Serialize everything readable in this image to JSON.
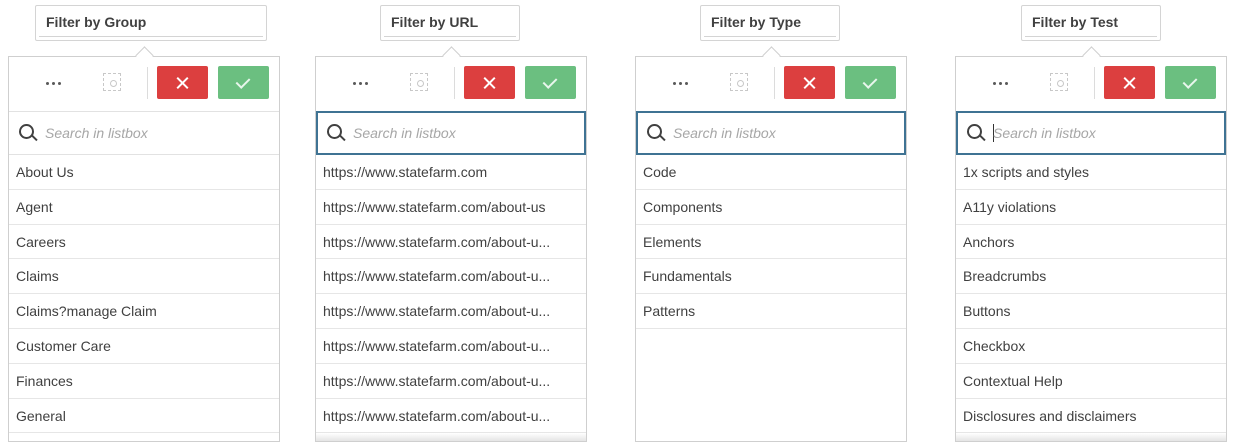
{
  "search_placeholder": "Search in listbox",
  "colors": {
    "cancel": "#dc3f3f",
    "confirm": "#6bbf80",
    "focus_border": "#3f7393"
  },
  "panels": [
    {
      "title": "Filter by Group",
      "items": [
        "About Us",
        "Agent",
        "Careers",
        "Claims",
        "Claims?manage Claim",
        "Customer Care",
        "Finances",
        "General"
      ]
    },
    {
      "title": "Filter by URL",
      "items": [
        "https://www.statefarm.com",
        "https://www.statefarm.com/about-us",
        "https://www.statefarm.com/about-u...",
        "https://www.statefarm.com/about-u...",
        "https://www.statefarm.com/about-u...",
        "https://www.statefarm.com/about-u...",
        "https://www.statefarm.com/about-u...",
        "https://www.statefarm.com/about-u..."
      ]
    },
    {
      "title": "Filter by Type",
      "items": [
        "Code",
        "Components",
        "Elements",
        "Fundamentals",
        "Patterns"
      ]
    },
    {
      "title": "Filter by Test",
      "items": [
        "1x scripts and styles",
        "A11y violations",
        "Anchors",
        "Breadcrumbs",
        "Buttons",
        "Checkbox",
        "Contextual Help",
        "Disclosures and disclaimers"
      ]
    }
  ]
}
